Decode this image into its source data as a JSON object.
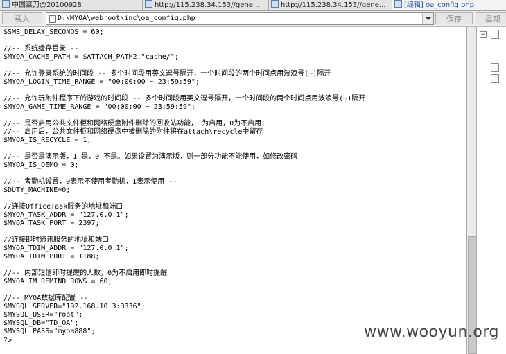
{
  "tabs": [
    {
      "label": "中国菜刀@20100928"
    },
    {
      "label": "http://115.238.34.153//gene..."
    },
    {
      "label": "http://115.238.34.153//gene..."
    },
    {
      "label": "[编辑] oa_config.php"
    }
  ],
  "toolbar": {
    "load_label": "载入",
    "path_value": "D:\\MYOA\\webroot\\inc\\oa_config.php",
    "save_label": "保存",
    "week_label": "星期"
  },
  "code_lines": [
    "$SMS_DELAY_SECONDS = 60;",
    "",
    "//-- 系统缓存目录 --",
    "$MYOA_CACHE_PATH = $ATTACH_PATH2.\"cache/\";",
    "",
    "//-- 允许登录系统的时间段 -- 多个时间段用英文逗号隔开，一个时间段的两个时间点用波浪号(~)隔开",
    "$MYOA_LOGIN_TIME_RANGE = \"00:00:00 ~ 23:59:59\";",
    "",
    "//-- 允许玩附件程序下的游戏的时间段 -- 多个时间段用英文逗号隔开，一个时间段的两个时间点用波浪号(~)隔开",
    "$MYOA_GAME_TIME_RANGE = \"00:00:00 ~ 23:59:59\";",
    "",
    "//-- 是否启用公共文件柜和网络硬盘附件删除的回收站功能，1为启用，0为不启用；",
    "//-- 启用后，公共文件柜和网络硬盘中被删除的附件将在attach\\recycle中留存",
    "$MYOA_IS_RECYCLE = 1;",
    "",
    "//-- 是否是演示版，1 是，0 不是。如果设置为演示版，则一部分功能不能使用，如修改密码",
    "$MYOA_IS_DEMO = 0;",
    "",
    "//-- 考勤机设置，0表示不使用考勤机，1表示使用 --",
    "$DUTY_MACHINE=0;",
    "",
    "//连接OfficeTask服务的地址和端口",
    "$MYOA_TASK_ADDR = \"127.0.0.1\";",
    "$MYOA_TASK_PORT = 2397;",
    "",
    "//连接即时通讯服务的地址和端口",
    "$MYOA_TDIM_ADDR = \"127.0.0.1\";",
    "$MYOA_TDIM_PORT = 1188;",
    "",
    "//-- 内部短信即时提醒的人数，0为不启用即时提醒",
    "$MYOA_IM_REMIND_ROWS = 60;",
    "",
    "//-- MYOA数据库配置 --",
    "$MYSQL_SERVER=\"192.168.10.3:3336\";",
    "$MYSQL_USER=\"root\";",
    "$MYSQL_DB=\"TD_OA\";",
    "$MYSQL_PASS=\"myoa888\";",
    "?>"
  ],
  "sidebar": {
    "tree_toggle": "−"
  },
  "watermark": "www.wooyun.org"
}
